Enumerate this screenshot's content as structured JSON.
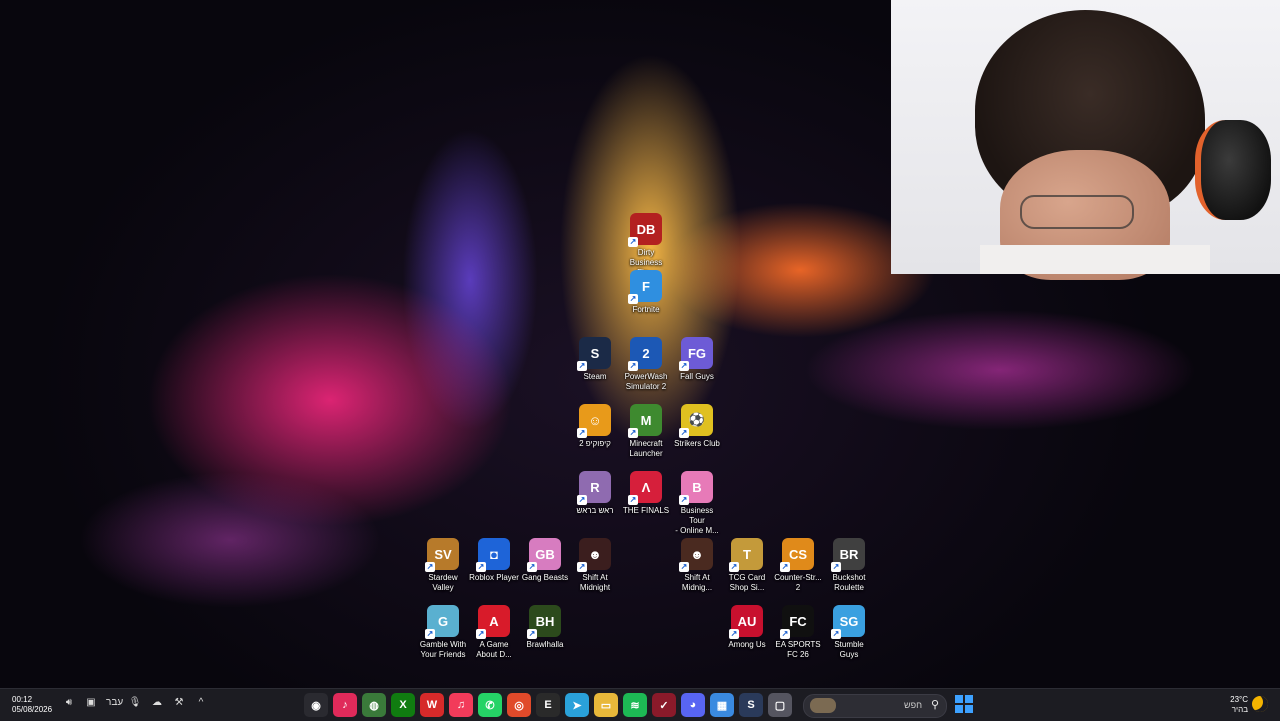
{
  "desktop": {
    "icons": [
      {
        "id": "dirty-business",
        "label": "Dirty\nBusiness Fin...",
        "color": "#b32020",
        "glyph": "DB"
      },
      {
        "id": "fortnite",
        "label": "Fortnite",
        "color": "#2f8fe0",
        "glyph": "F"
      },
      {
        "id": "steam",
        "label": "Steam",
        "color": "#1b2a47",
        "glyph": "S"
      },
      {
        "id": "powerwash",
        "label": "PowerWash\nSimulator 2",
        "color": "#1c58b5",
        "glyph": "2"
      },
      {
        "id": "fall-guys",
        "label": "Fall Guys",
        "color": "#6d5bd6",
        "glyph": "FG"
      },
      {
        "id": "hebrew-game-1",
        "label": "2 קיפוקיפ",
        "color": "#e89a1a",
        "glyph": "☺"
      },
      {
        "id": "minecraft",
        "label": "Minecraft\nLauncher",
        "color": "#3e8a2f",
        "glyph": "M"
      },
      {
        "id": "strikers-club",
        "label": "Strikers Club",
        "color": "#e0c020",
        "glyph": "⚽"
      },
      {
        "id": "hebrew-game-2",
        "label": "ראש בראש",
        "color": "#8f6bb0",
        "glyph": "R"
      },
      {
        "id": "the-finals",
        "label": "THE FINALS",
        "color": "#d61f3b",
        "glyph": "Λ"
      },
      {
        "id": "business-tour",
        "label": "Business Tour\n- Online M...",
        "color": "#e77ab8",
        "glyph": "B"
      },
      {
        "id": "stardew",
        "label": "Stardew\nValley",
        "color": "#b77a2a",
        "glyph": "SV"
      },
      {
        "id": "roblox",
        "label": "Roblox Player",
        "color": "#1e64d8",
        "glyph": "◘"
      },
      {
        "id": "gang-beasts",
        "label": "Gang Beasts",
        "color": "#d77cc0",
        "glyph": "GB"
      },
      {
        "id": "shift-midnight-1",
        "label": "Shift At\nMidnight",
        "color": "#3b1e1e",
        "glyph": "☻"
      },
      {
        "id": "shift-midnight-2",
        "label": "Shift At\nMidnig...",
        "color": "#4a2a20",
        "glyph": "☻"
      },
      {
        "id": "tcg-card",
        "label": "TCG Card\nShop Si...",
        "color": "#c49a3a",
        "glyph": "T"
      },
      {
        "id": "counter-strike",
        "label": "Counter-Str...\n2",
        "color": "#e08a1a",
        "glyph": "CS"
      },
      {
        "id": "buckshot",
        "label": "Buckshot\nRoulette",
        "color": "#404040",
        "glyph": "BR"
      },
      {
        "id": "gamble",
        "label": "Gamble With\nYour Friends",
        "color": "#5ab0d0",
        "glyph": "G"
      },
      {
        "id": "a-game-about",
        "label": "A Game\nAbout D...",
        "color": "#d81b2a",
        "glyph": "A"
      },
      {
        "id": "brawlhalla",
        "label": "Brawlhalla",
        "color": "#2c4a1c",
        "glyph": "BH"
      },
      {
        "id": "among-us",
        "label": "Among Us",
        "color": "#c8102e",
        "glyph": "AU"
      },
      {
        "id": "ea-fc",
        "label": "EA SPORTS\nFC 26",
        "color": "#101010",
        "glyph": "FC"
      },
      {
        "id": "stumble-guys",
        "label": "Stumble\nGuys",
        "color": "#3aa0e0",
        "glyph": "SG"
      }
    ]
  },
  "taskbar": {
    "time": "00:12",
    "date": "05/08/2026",
    "language": "עבר",
    "search_placeholder": "חפש",
    "weather_temp": "23°C",
    "weather_text": "בהיר",
    "apps": [
      {
        "id": "obs",
        "glyph": "◉",
        "color": "#2a2a30"
      },
      {
        "id": "tiktok",
        "glyph": "♪",
        "color": "#e02a5a"
      },
      {
        "id": "chrome-active",
        "glyph": "◍",
        "color": "#3a7a3a"
      },
      {
        "id": "xbox",
        "glyph": "X",
        "color": "#107c10"
      },
      {
        "id": "wps",
        "glyph": "W",
        "color": "#d62a2a"
      },
      {
        "id": "music",
        "glyph": "♫",
        "color": "#f23b5a"
      },
      {
        "id": "whatsapp",
        "glyph": "✆",
        "color": "#25d366"
      },
      {
        "id": "chrome",
        "glyph": "◎",
        "color": "#e04a2a"
      },
      {
        "id": "epic",
        "glyph": "E",
        "color": "#2a2a2a"
      },
      {
        "id": "telegram",
        "glyph": "➤",
        "color": "#2aa1da"
      },
      {
        "id": "explorer",
        "glyph": "▭",
        "color": "#e8b83a"
      },
      {
        "id": "spotify",
        "glyph": "≋",
        "color": "#1db954"
      },
      {
        "id": "capcut",
        "glyph": "✓",
        "color": "#8a1a2a"
      },
      {
        "id": "discord",
        "glyph": "◕",
        "color": "#5865f2"
      },
      {
        "id": "store",
        "glyph": "▦",
        "color": "#3a8ae0"
      },
      {
        "id": "steam",
        "glyph": "S",
        "color": "#2a3a5a"
      },
      {
        "id": "window",
        "glyph": "▢",
        "color": "#555560"
      }
    ]
  }
}
